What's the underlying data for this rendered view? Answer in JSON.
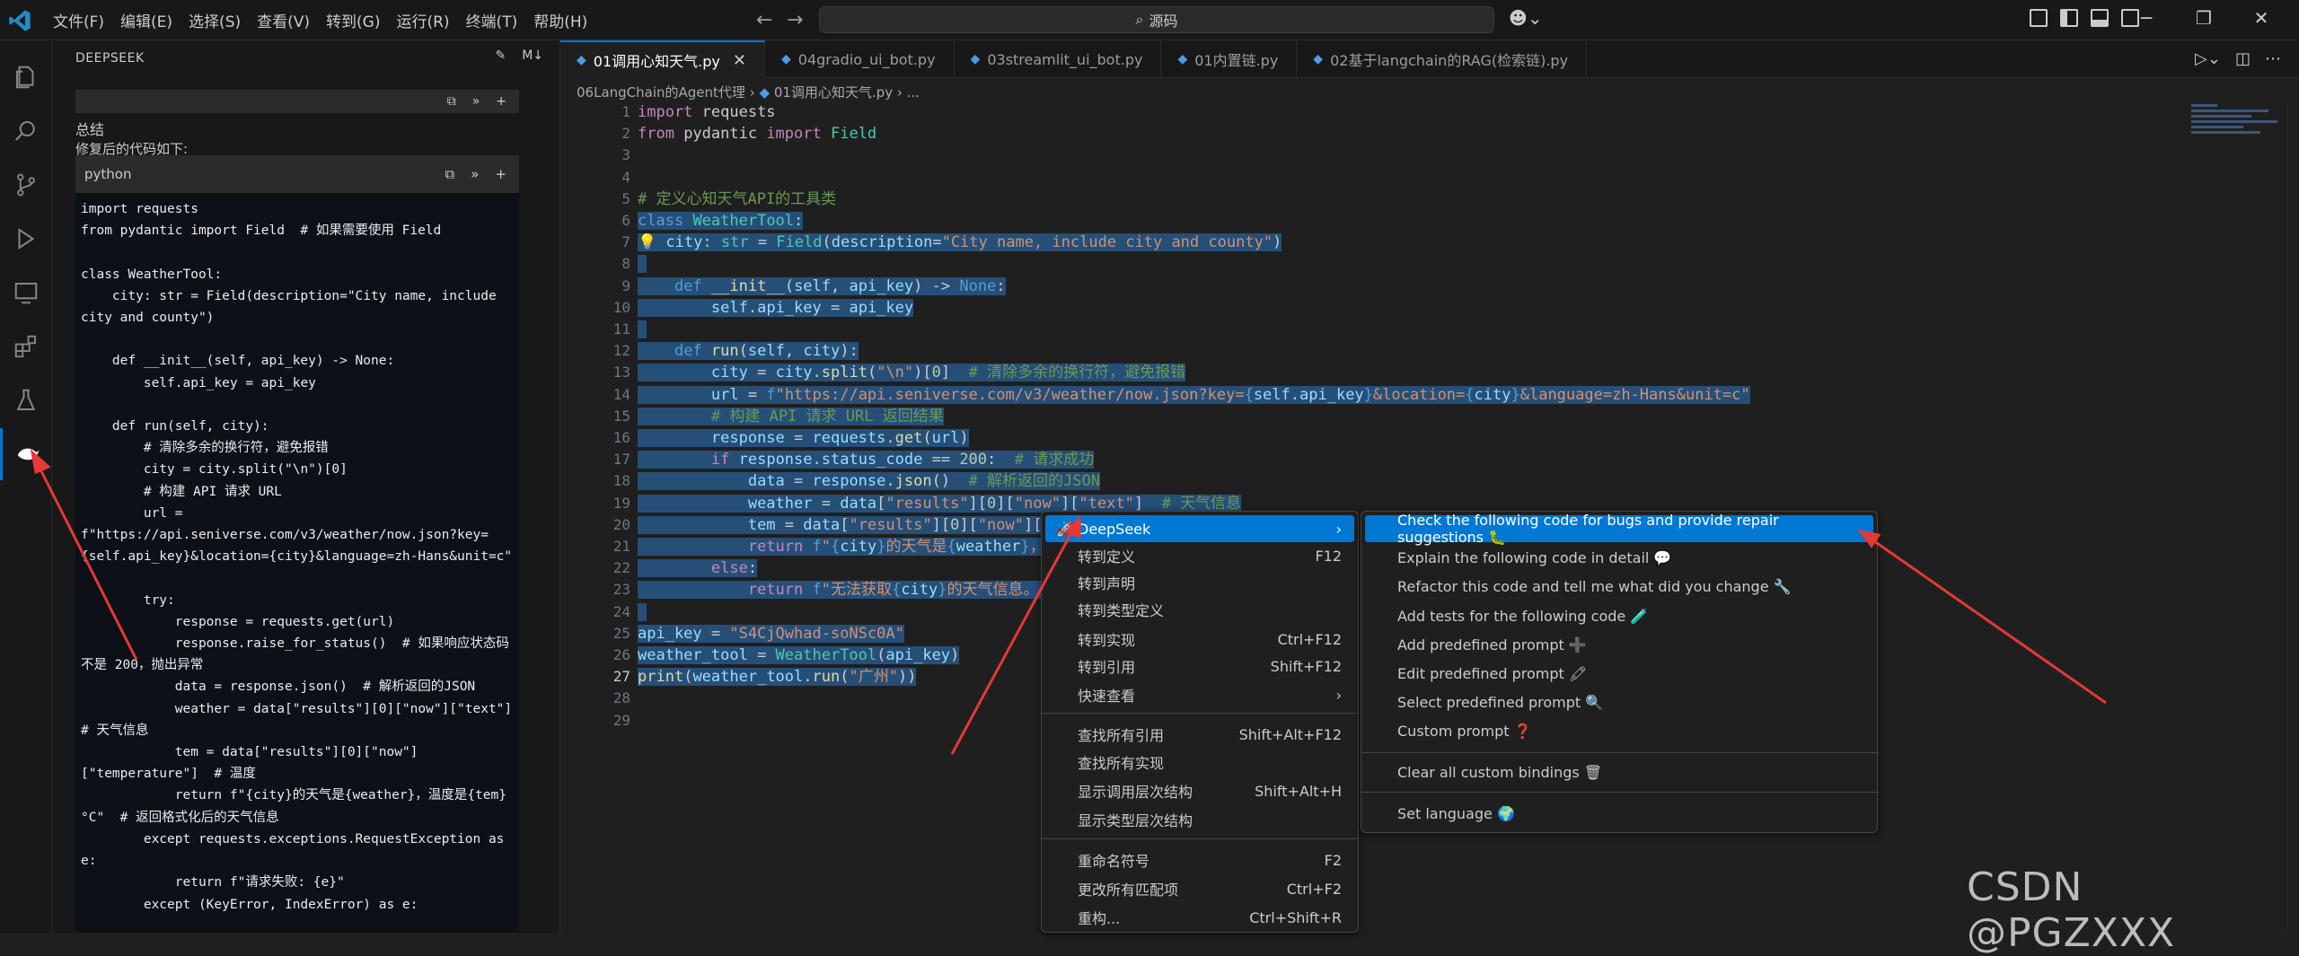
{
  "menubar": [
    "文件(F)",
    "编辑(E)",
    "选择(S)",
    "查看(V)",
    "转到(G)",
    "运行(R)",
    "终端(T)",
    "帮助(H)"
  ],
  "command_center": "源码",
  "sidebar": {
    "title": "DEEPSEEK",
    "summary": "总结",
    "final_code_label": "修复后的代码如下:",
    "code_lang": "python",
    "code_lines": [
      "import requests",
      "from pydantic import Field  # 如果需要使用 Field",
      "",
      "class WeatherTool:",
      "    city: str = Field(description=\"City name, include city and county\")",
      "",
      "    def __init__(self, api_key) -> None:",
      "        self.api_key = api_key",
      "",
      "    def run(self, city):",
      "        # 清除多余的换行符，避免报错",
      "        city = city.split(\"\\n\")[0]",
      "        # 构建 API 请求 URL",
      "        url =",
      "f\"https://api.seniverse.com/v3/weather/now.json?key={self.api_key}&location={city}&language=zh-Hans&unit=c\"",
      "",
      "        try:",
      "            response = requests.get(url)",
      "            response.raise_for_status()  # 如果响应状态码不是 200，抛出异常",
      "            data = response.json()  # 解析返回的JSON",
      "            weather = data[\"results\"][0][\"now\"][\"text\"]  # 天气信息",
      "            tem = data[\"results\"][0][\"now\"][\"temperature\"]  # 温度",
      "            return f\"{city}的天气是{weather}，温度是{tem}°C\"  # 返回格式化后的天气信息",
      "        except requests.exceptions.RequestException as e:",
      "            return f\"请求失败: {e}\"",
      "        except (KeyError, IndexError) as e:"
    ]
  },
  "tabs": [
    {
      "label": "01调用心知天气.py",
      "active": true
    },
    {
      "label": "04gradio_ui_bot.py",
      "active": false
    },
    {
      "label": "03streamlit_ui_bot.py",
      "active": false
    },
    {
      "label": "01内置链.py",
      "active": false
    },
    {
      "label": "02基于langchain的RAG(检索链).py",
      "active": false
    }
  ],
  "breadcrumb": {
    "folder": "06LangChain的Agent代理",
    "file": "01调用心知天气.py",
    "more": "..."
  },
  "editor": {
    "current_line": 27,
    "line_numbers": [
      1,
      2,
      3,
      4,
      5,
      6,
      7,
      8,
      9,
      10,
      11,
      12,
      13,
      14,
      15,
      16,
      17,
      18,
      19,
      20,
      21,
      22,
      23,
      24,
      25,
      26,
      27,
      28,
      29
    ]
  },
  "context_menu": {
    "items": [
      {
        "label": "DeepSeek",
        "shortcut": "",
        "submenu": true,
        "highlighted": true
      },
      {
        "label": "转到定义",
        "shortcut": "F12"
      },
      {
        "label": "转到声明",
        "shortcut": ""
      },
      {
        "label": "转到类型定义",
        "shortcut": ""
      },
      {
        "label": "转到实现",
        "shortcut": "Ctrl+F12"
      },
      {
        "label": "转到引用",
        "shortcut": "Shift+F12"
      },
      {
        "label": "快速查看",
        "shortcut": "",
        "submenu": true
      },
      {
        "label": "查找所有引用",
        "shortcut": "Shift+Alt+F12"
      },
      {
        "label": "查找所有实现",
        "shortcut": ""
      },
      {
        "label": "显示调用层次结构",
        "shortcut": "Shift+Alt+H"
      },
      {
        "label": "显示类型层次结构",
        "shortcut": ""
      },
      {
        "label": "重命名符号",
        "shortcut": "F2"
      },
      {
        "label": "更改所有匹配项",
        "shortcut": "Ctrl+F2"
      },
      {
        "label": "重构...",
        "shortcut": "Ctrl+Shift+R"
      }
    ]
  },
  "submenu": {
    "items": [
      {
        "label": "Check the following code for bugs and provide repair suggestions 🐛",
        "highlighted": true
      },
      {
        "label": "Explain the following code in detail 💬"
      },
      {
        "label": "Refactor this code and tell me what did you change 🔧"
      },
      {
        "label": "Add tests for the following code 🧪"
      },
      {
        "label": "Add predefined prompt ➕"
      },
      {
        "label": "Edit predefined prompt 🖍"
      },
      {
        "label": "Select predefined prompt 🔍"
      },
      {
        "label": "Custom prompt ❓"
      },
      {
        "label": "Clear all custom bindings 🗑"
      },
      {
        "label": "Set language 🌍"
      }
    ]
  },
  "watermark": "CSDN @PGZXXX",
  "colors": {
    "accent": "#0078d4",
    "annotation_arrow": "#e53935"
  }
}
